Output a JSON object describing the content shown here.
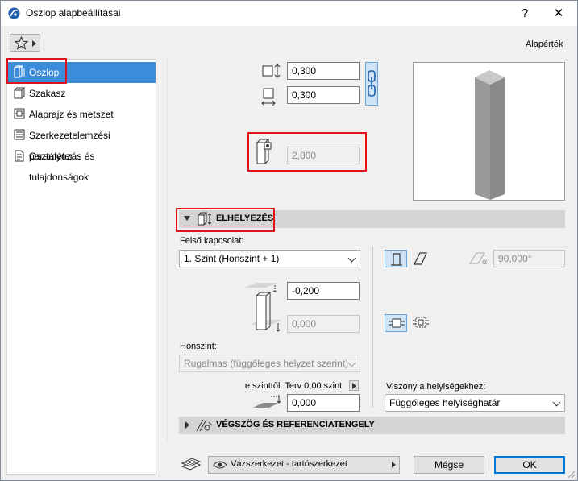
{
  "window": {
    "title": "Oszlop alapbeállításai",
    "help_label": "?",
    "close_label": "✕"
  },
  "header": {
    "favorites_icon": "star-icon",
    "default_label": "Alapérték"
  },
  "sidebar": {
    "items": [
      {
        "label": "Oszlop",
        "icon": "column-icon",
        "selected": true
      },
      {
        "label": "Szakasz",
        "icon": "segment-icon",
        "selected": false
      },
      {
        "label": "Alaprajz és metszet",
        "icon": "floorplan-icon",
        "selected": false
      },
      {
        "label": "Szerkezetelemzési paraméter...",
        "icon": "structural-analysis-icon",
        "selected": false
      },
      {
        "label": "Osztályozás és tulajdonságok",
        "icon": "classification-icon",
        "selected": false
      }
    ]
  },
  "geometry": {
    "width_value": "0,300",
    "depth_value": "0,300",
    "height_value": "2,800",
    "link_icon": "chain-link-icon"
  },
  "placement": {
    "section_title": "ELHELYEZÉS",
    "top_link_label": "Felső kapcsolat:",
    "top_link_value": "1. Szint (Honszint + 1)",
    "top_offset_value": "-0,200",
    "bottom_offset_value": "0,000",
    "home_story_label": "Honszint:",
    "home_story_value": "Rugalmas (függőleges helyzet szerint)",
    "base_ref_label": "e szinttől: Terv 0,00 szint",
    "base_ref_value": "0,000",
    "angle_value": "90,000°",
    "relation_label": "Viszony a helyiségekhez:",
    "relation_value": "Függőleges helyiséghatár"
  },
  "end_cut": {
    "section_title": "VÉGSZÖG ÉS REFERENCIATENGELY"
  },
  "footer": {
    "structure_label": "Vázszerkezet - tartószerkezet",
    "cancel_label": "Mégse",
    "ok_label": "OK"
  },
  "colors": {
    "accent": "#3b8cdb",
    "highlight_box": "#e0121a",
    "section_bar": "#d4d4d4"
  }
}
